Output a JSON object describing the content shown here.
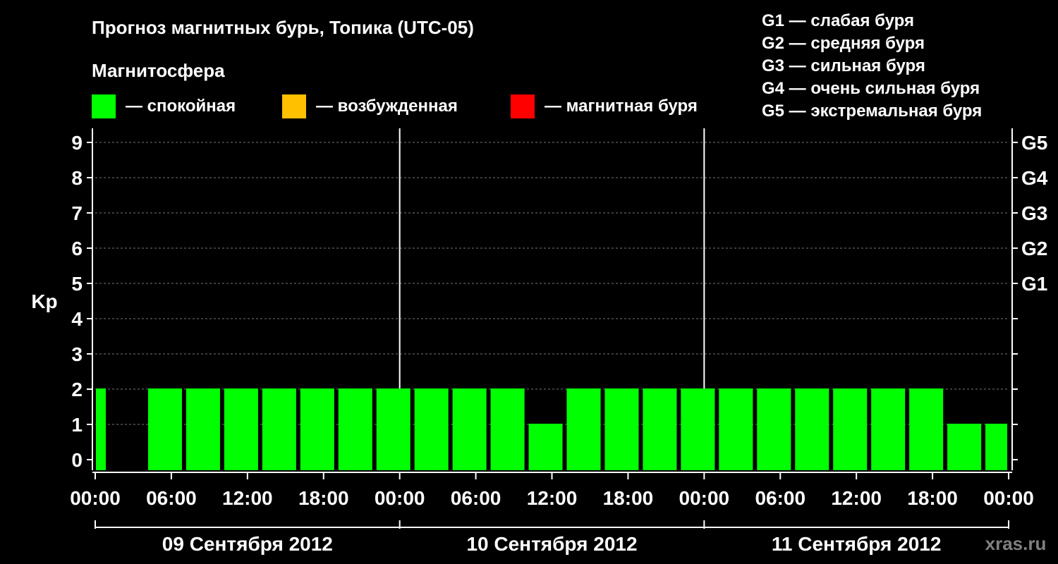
{
  "title": "Прогноз магнитных бурь, Топика (UTC-05)",
  "magnetosphere_label": "Магнитосфера",
  "legend": [
    {
      "color": "#00ff00",
      "label": "— спокойная"
    },
    {
      "color": "#ffc000",
      "label": "— возбужденная"
    },
    {
      "color": "#ff0000",
      "label": "— магнитная буря"
    }
  ],
  "g_legend": [
    "G1 — слабая буря",
    "G2 — средняя буря",
    "G3 — сильная буря",
    "G4 — очень сильная буря",
    "G5 — экстремальная буря"
  ],
  "watermark": "xras.ru",
  "chart_data": {
    "type": "bar",
    "ylabel": "Kp",
    "ylim": [
      0,
      9
    ],
    "y_ticks": [
      "0",
      "1",
      "2",
      "3",
      "4",
      "5",
      "6",
      "7",
      "8",
      "9"
    ],
    "right_axis_labels": [
      {
        "kp": 5,
        "label": "G1"
      },
      {
        "kp": 6,
        "label": "G2"
      },
      {
        "kp": 7,
        "label": "G3"
      },
      {
        "kp": 8,
        "label": "G4"
      },
      {
        "kp": 9,
        "label": "G5"
      }
    ],
    "x_tick_labels": [
      "00:00",
      "06:00",
      "12:00",
      "18:00",
      "00:00",
      "06:00",
      "12:00",
      "18:00",
      "00:00",
      "06:00",
      "12:00",
      "18:00",
      "00:00"
    ],
    "days": [
      "09 Сентября 2012",
      "10 Сентября 2012",
      "11 Сентября 2012"
    ],
    "interval_hours": 3,
    "values": [
      2,
      2,
      2,
      2,
      2,
      2,
      2,
      2,
      2,
      2,
      2,
      1,
      2,
      2,
      2,
      2,
      2,
      2,
      2,
      2,
      2,
      2,
      1,
      1
    ],
    "bar_color": "#00ff00",
    "grid": true
  }
}
